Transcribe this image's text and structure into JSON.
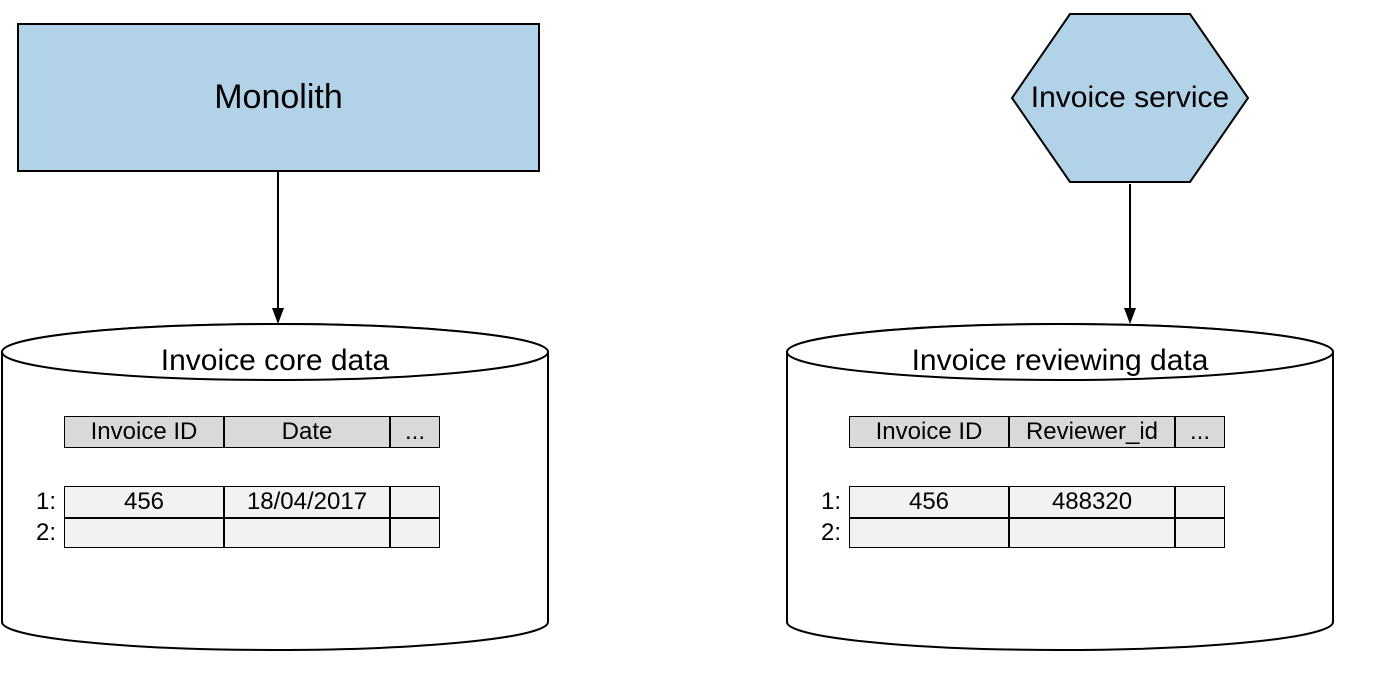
{
  "monolith": {
    "label": "Monolith"
  },
  "invoice_service": {
    "label": "Invoice service"
  },
  "db_left": {
    "title": "Invoice core data",
    "headers": {
      "a": "Invoice ID",
      "b": "Date",
      "c": "..."
    },
    "rows": [
      {
        "label": "1:",
        "a": "456",
        "b": "18/04/2017",
        "c": ""
      },
      {
        "label": "2:",
        "a": "",
        "b": "",
        "c": ""
      }
    ]
  },
  "db_right": {
    "title": "Invoice reviewing data",
    "headers": {
      "a": "Invoice ID",
      "b": "Reviewer_id",
      "c": "..."
    },
    "rows": [
      {
        "label": "1:",
        "a": "456",
        "b": "488320",
        "c": ""
      },
      {
        "label": "2:",
        "a": "",
        "b": "",
        "c": ""
      }
    ]
  }
}
